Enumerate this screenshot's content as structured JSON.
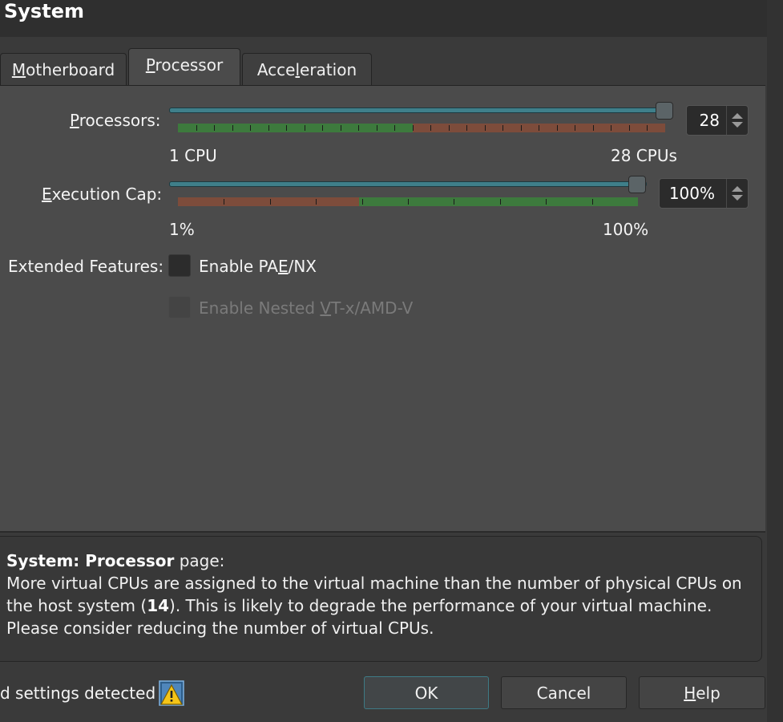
{
  "window": {
    "title": "System"
  },
  "tabs": [
    {
      "label": "Motherboard",
      "mnemonic": "M",
      "rest": "otherboard"
    },
    {
      "label": "Processor",
      "mnemonic": "P",
      "rest": "rocessor"
    },
    {
      "label": "Acceleration",
      "pre": "Acce",
      "mnemonic": "l",
      "rest": "eration"
    }
  ],
  "active_tab": "Processor",
  "processors": {
    "label_mnemonic": "P",
    "label_rest": "rocessors:",
    "min_label": "1 CPU",
    "max_label": "28 CPUs",
    "value": "28",
    "slider_min": 1,
    "slider_max": 28,
    "slider_value": 28,
    "recommended_max": 14
  },
  "execution_cap": {
    "label_mnemonic": "E",
    "label_rest": "xecution Cap:",
    "min_label": "1%",
    "max_label": "100%",
    "value": "100%",
    "slider_value_percent": 100
  },
  "extended_features": {
    "label": "Extended Features:",
    "pae": {
      "pre": "Enable PA",
      "mnemonic": "E",
      "rest": "/NX",
      "checked": false,
      "enabled": true
    },
    "nested": {
      "pre": "Enable Nested ",
      "mnemonic": "V",
      "rest": "T-x/AMD-V",
      "checked": false,
      "enabled": false
    }
  },
  "message": {
    "heading_bold": "System: Processor",
    "heading_rest": " page:",
    "line1": "More virtual CPUs are assigned to the virtual machine than the number of physical CPUs on",
    "line2_pre": "the host system (",
    "line2_bold": "14",
    "line2_post": "). This is likely to degrade the performance of your virtual machine.",
    "line3": "Please consider reducing the number of virtual CPUs."
  },
  "footer": {
    "status_text": "d settings detected",
    "warning_icon": "warning-icon",
    "ok_label": "OK",
    "cancel_label": "Cancel",
    "help_mnemonic": "H",
    "help_rest": "elp"
  },
  "colors": {
    "accent": "#3f7f8a",
    "scale_green": "#3d7a3d",
    "scale_red": "#7d4c3b",
    "panel": "#4b4b4b"
  }
}
